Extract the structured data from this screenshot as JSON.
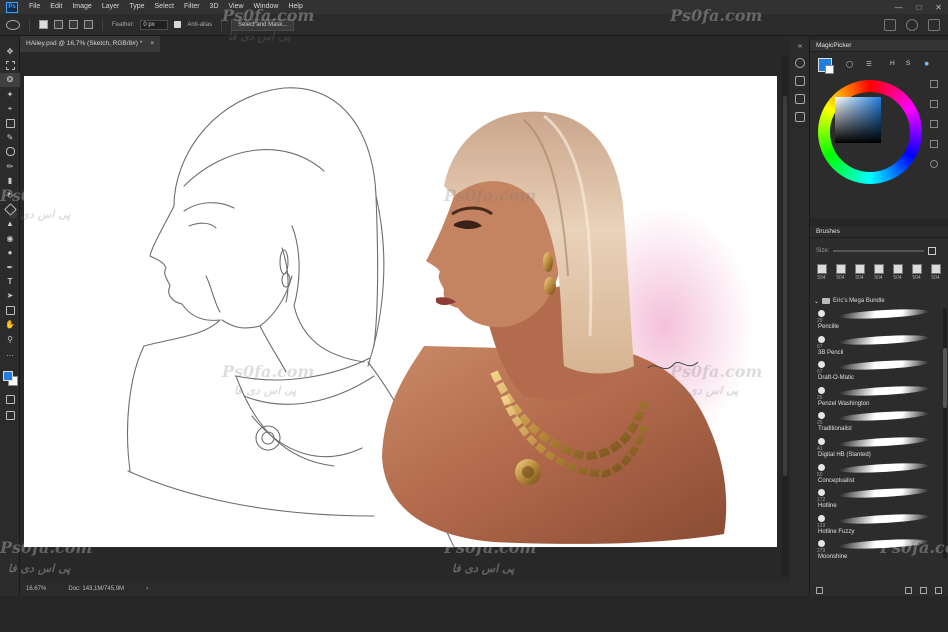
{
  "menu": {
    "logo": "Ps",
    "items": [
      "File",
      "Edit",
      "Image",
      "Layer",
      "Type",
      "Select",
      "Filter",
      "3D",
      "View",
      "Window",
      "Help"
    ]
  },
  "options": {
    "feather_label": "Feather:",
    "feather_value": "0 px",
    "antialias_label": "Anti-alias",
    "select_mask_label": "Select and Mask..."
  },
  "document": {
    "tab_title": "HAiley.psd @ 16,7% (Sketch, RGB/8#) *",
    "tab_close": "×"
  },
  "status": {
    "zoom": "16,67%",
    "doc_info": "Doc: 143,1M/745,9M"
  },
  "magicpicker": {
    "title": "MagicPicker",
    "tab_h": "H",
    "tab_s": "S"
  },
  "brushes": {
    "title": "Brushes",
    "size_label": "Size:",
    "preset_numbers": [
      "504",
      "504",
      "504",
      "504",
      "504",
      "504",
      "504"
    ],
    "group_name": "Eric's Mega Bundle",
    "items": [
      {
        "size": "29",
        "name": "Pencille"
      },
      {
        "size": "67",
        "name": "3B Pencil"
      },
      {
        "size": "67",
        "name": "Draft-O-Matic"
      },
      {
        "size": "25",
        "name": "Penzel Washington"
      },
      {
        "size": "25",
        "name": "Traditionalist"
      },
      {
        "size": "41",
        "name": "Digital HB (Slanted)"
      },
      {
        "size": "50",
        "name": "Conceptualist"
      },
      {
        "size": "172",
        "name": "Hotline"
      },
      {
        "size": "129",
        "name": "Hotline Fuzzy"
      },
      {
        "size": "279",
        "name": "Moonshine"
      }
    ]
  },
  "watermarks": {
    "latin": "Ps0fa.com",
    "persian": "پی اس دی فا"
  },
  "colors": {
    "foreground": "#1f7fe0",
    "background": "#ffffff",
    "panel": "#262626"
  }
}
